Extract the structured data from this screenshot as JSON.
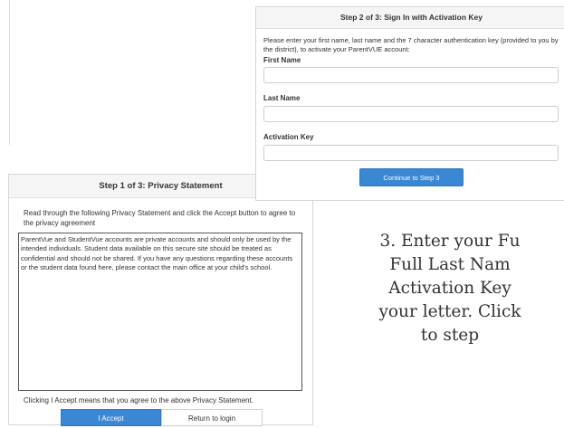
{
  "step1": {
    "title": "Step 1 of 3: Privacy Statement",
    "intro": "Read through the following Privacy Statement and click the Accept button to agree to the privacy agreement",
    "privacy_text": "ParentVue and StudentVue accounts are private accounts and should only be used by the intended individuals. Student data available on this secure site should be treated as confidential and should not be shared. If you have any questions regarding these accounts or the student data found here, please contact the main office at your child's school.",
    "accept_note": "Clicking I Accept means that you agree to the above Privacy Statement.",
    "accept_label": "I Accept",
    "return_label": "Return to login"
  },
  "step2": {
    "title": "Step 2 of 3: Sign In with Activation Key",
    "intro": "Please enter your first name, last name and the 7 character authentication key (provided to you by the district), to activate your ParentVUE account:",
    "first_name_label": "First Name",
    "last_name_label": "Last Name",
    "activation_key_label": "Activation Key",
    "continue_label": "Continue to Step 3"
  },
  "instruction": {
    "text": "3. Enter your Fu\nFull Last Nam\nActivation Key\nyour letter. Click\nto step"
  },
  "colors": {
    "primary_button": "#3a87d4",
    "header_bg": "#f5f5f5"
  }
}
